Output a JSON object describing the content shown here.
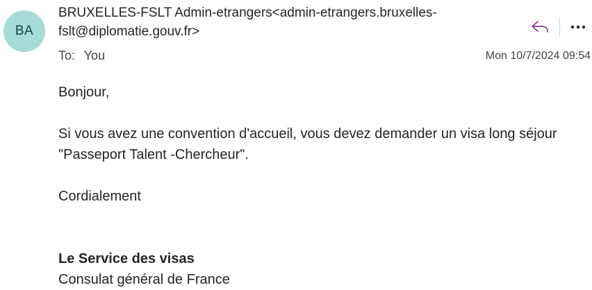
{
  "header": {
    "avatar_initials": "BA",
    "avatar_color": "#a7dcd6",
    "sender": "BRUXELLES-FSLT Admin-etrangers<admin-etrangers.bruxelles-fslt@diplomatie.gouv.fr>",
    "to_label": "To:",
    "to_value": "You",
    "date": "Mon 10/7/2024 09:54",
    "actions": {
      "reply_icon": "reply-arrow-icon",
      "more_icon": "more-horizontal-icon",
      "accent_color": "#8a3a9e"
    }
  },
  "message": {
    "greeting": "Bonjour,",
    "paragraph": "Si vous avez une convention d'accueil, vous devez demander un visa long séjour \"Passeport Talent -Chercheur\".",
    "closing": "Cordialement",
    "signature_name": "Le Service des visas",
    "signature_org": "Consulat général de France"
  }
}
